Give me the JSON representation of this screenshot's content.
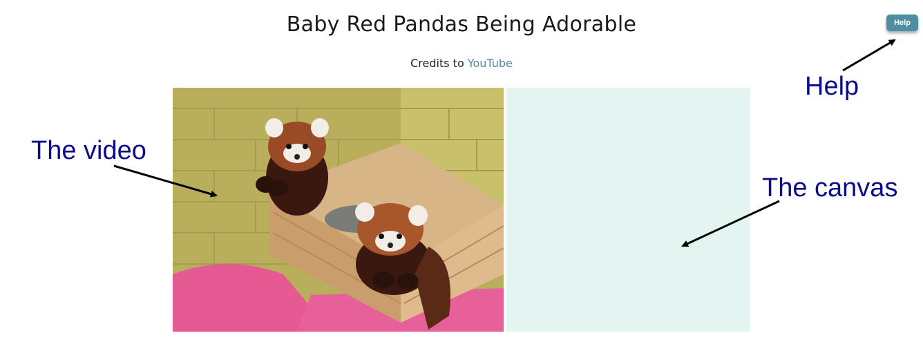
{
  "page": {
    "title": "Baby Red Pandas Being Adorable",
    "credits_prefix": "Credits to ",
    "credits_link": "YouTube",
    "help_button": "Help"
  },
  "annotations": {
    "help": "Help",
    "video": "The video",
    "canvas": "The canvas"
  },
  "colors": {
    "accent": "#4f8ea0",
    "link": "#4f8aa0",
    "canvas_bg": "#e4f4f1",
    "annotation": "#0c0c8c"
  },
  "media": {
    "video_subject": "two baby red pandas in a wooden box"
  }
}
